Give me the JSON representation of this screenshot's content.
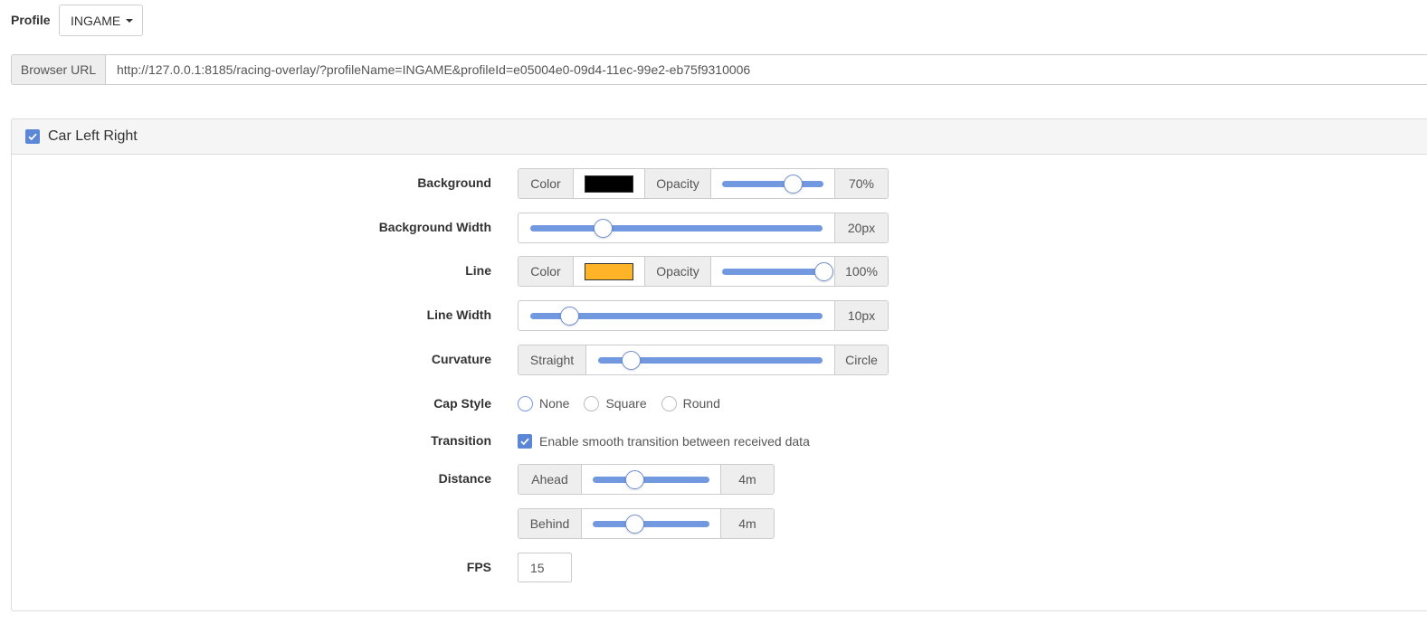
{
  "profile": {
    "label": "Profile",
    "selected": "INGAME"
  },
  "browser_url": {
    "label": "Browser URL",
    "value": "http://127.0.0.1:8185/racing-overlay/?profileName=INGAME&profileId=e05004e0-09d4-11ec-99e2-eb75f9310006"
  },
  "panel": {
    "title": "Car Left Right",
    "enabled": true,
    "background": {
      "label": "Background",
      "color_label": "Color",
      "color": "#000000",
      "opacity_label": "Opacity",
      "opacity": "70%",
      "opacity_fraction": 0.7
    },
    "background_width": {
      "label": "Background Width",
      "value": "20px",
      "fraction": 0.25
    },
    "line": {
      "label": "Line",
      "color_label": "Color",
      "color": "#ffb428",
      "opacity_label": "Opacity",
      "opacity": "100%",
      "opacity_fraction": 1.0
    },
    "line_width": {
      "label": "Line Width",
      "value": "10px",
      "fraction": 0.135
    },
    "curvature": {
      "label": "Curvature",
      "min_label": "Straight",
      "max_label": "Circle",
      "fraction": 0.147
    },
    "cap_style": {
      "label": "Cap Style",
      "options": [
        {
          "label": "None",
          "checked": false
        },
        {
          "label": "Square",
          "checked": true
        },
        {
          "label": "Round",
          "checked": false
        }
      ]
    },
    "transition": {
      "label": "Transition",
      "checkbox_label": "Enable smooth transition between received data",
      "checked": true
    },
    "distance": {
      "label": "Distance",
      "ahead_label": "Ahead",
      "ahead_value": "4m",
      "ahead_fraction": 0.36,
      "behind_label": "Behind",
      "behind_value": "4m",
      "behind_fraction": 0.36
    },
    "fps": {
      "label": "FPS",
      "value": "15"
    }
  },
  "colors": {
    "accent": "#5b87d6",
    "slider_track": "#7298e0",
    "addon_bg": "#eeeeee",
    "border": "#cccccc"
  }
}
